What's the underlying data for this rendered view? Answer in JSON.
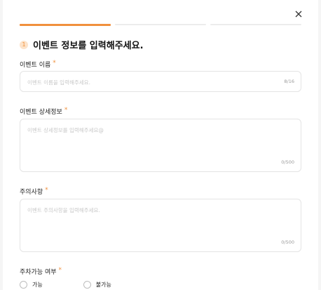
{
  "modal": {
    "close_icon": "close-icon",
    "progress_steps": 3,
    "active_step": 1,
    "accent_color": "#f0903d"
  },
  "step": {
    "number": "1",
    "title": "이벤트 정보를 입력해주세요."
  },
  "fields": {
    "event_name": {
      "label": "이벤트 이름",
      "required_mark": "*",
      "placeholder": "이벤트 이름을 입력해주세요.",
      "counter": "8/16"
    },
    "event_detail": {
      "label": "이벤트 상세정보",
      "required_mark": "*",
      "placeholder": "이벤트 상세정보를 입력해주세요@",
      "counter": "0/500"
    },
    "notice": {
      "label": "주의사항",
      "required_mark": "*",
      "placeholder": "이벤트 주의사항을 입력해주세요.",
      "counter": "0/500"
    },
    "parking": {
      "label": "주차가능 여부",
      "required_mark": "*",
      "options": [
        "가능",
        "불가능"
      ]
    }
  }
}
